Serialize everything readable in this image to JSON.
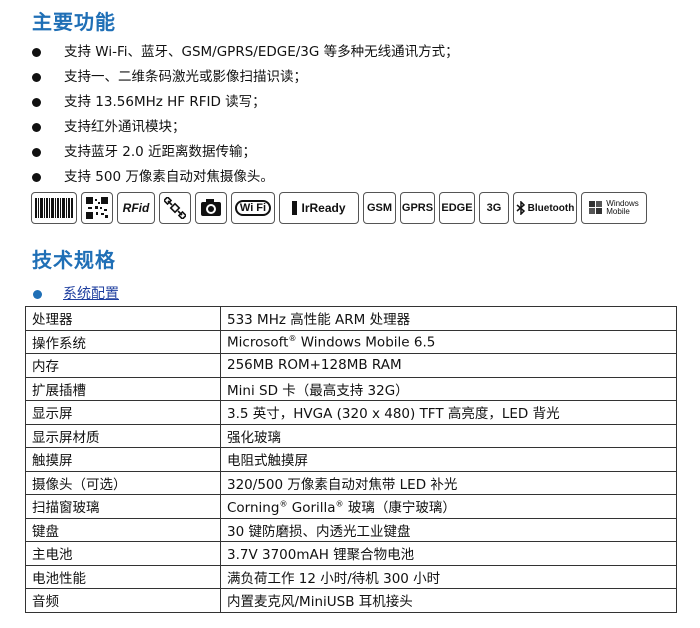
{
  "sections": {
    "features_title": "主要功能",
    "spec_title": "技术规格",
    "subsection": "系统配置"
  },
  "features": [
    "支持 Wi-Fi、蓝牙、GSM/GPRS/EDGE/3G 等多种无线通讯方式；",
    "支持一、二维条码激光或影像扫描识读；",
    "支持 13.56MHz HF RFID  读写；",
    "支持红外通讯模块；",
    "支持蓝牙 2.0 近距离数据传输；",
    "支持 500 万像素自动对焦摄像头。"
  ],
  "badges": {
    "rfid": "RFid",
    "wifi": "Wi Fi",
    "irready": "IrReady",
    "gsm": "GSM",
    "gprs": "GPRS",
    "edge": "EDGE",
    "g3": "3G",
    "bluetooth": "Bluetooth",
    "windows_mobile_1": "Windows",
    "windows_mobile_2": "Mobile"
  },
  "icons": [
    "barcode-icon",
    "qrcode-icon",
    "rfid-icon",
    "satellite-icon",
    "camera-icon",
    "wifi-icon",
    "irready-icon",
    "gsm-icon",
    "gprs-icon",
    "edge-icon",
    "3g-icon",
    "bluetooth-icon",
    "windows-mobile-icon"
  ],
  "spec_rows": [
    {
      "k": "处理器",
      "v": "533 MHz  高性能  ARM  处理器"
    },
    {
      "k": "操作系统",
      "v_pre": "Microsoft",
      "v_sup": "®",
      "v_post": " Windows Mobile 6.5"
    },
    {
      "k": "内存",
      "v": "256MB ROM+128MB RAM"
    },
    {
      "k": "扩展插槽",
      "v": "Mini SD  卡（最高支持 32G）"
    },
    {
      "k": "显示屏",
      "v": "3.5 英寸，HVGA (320 x 480) TFT  高亮度，LED  背光"
    },
    {
      "k": "显示屏材质",
      "v": "强化玻璃"
    },
    {
      "k": "触摸屏",
      "v": "电阻式触摸屏"
    },
    {
      "k": "摄像头（可选）",
      "v": "320/500 万像素自动对焦带 LED 补光"
    },
    {
      "k": "扫描窗玻璃",
      "v_pre": "Corning",
      "v_sup": "®",
      "v_mid": " Gorilla",
      "v_sup2": "®",
      "v_post": "  玻璃（康宁玻璃）"
    },
    {
      "k": "键盘",
      "v": "30 键防磨损、内透光工业键盘"
    },
    {
      "k": "主电池",
      "v": "3.7V 3700mAH  锂聚合物电池"
    },
    {
      "k": "电池性能",
      "v": "满负荷工作 12 小时/待机 300 小时"
    },
    {
      "k": "音频",
      "v": "内置麦克风/MiniUSB 耳机接头"
    }
  ],
  "colors": {
    "heading": "#1f6fb6",
    "link": "#1f3f9f"
  }
}
